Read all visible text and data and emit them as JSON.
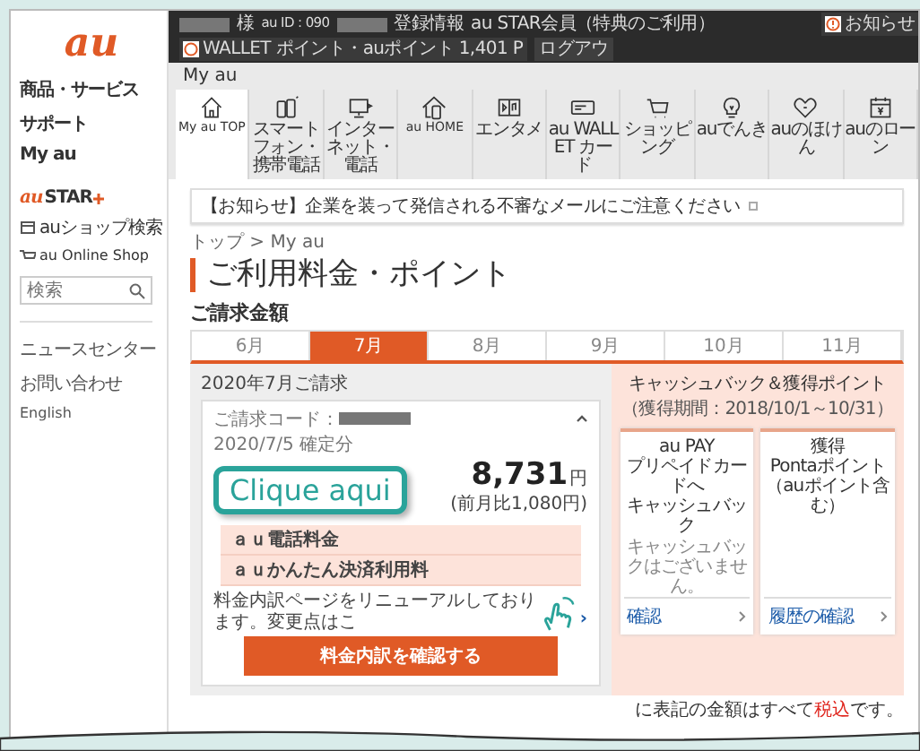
{
  "sidebar": {
    "logo": "au",
    "menu": [
      "商品・サービス",
      "サポート",
      "My au"
    ],
    "star_logo": {
      "brand": "au",
      "name": "STAR"
    },
    "links": [
      {
        "kind": "shop",
        "label": "auショップ検索"
      },
      {
        "kind": "online",
        "label": "au Online Shop"
      }
    ],
    "search": {
      "placeholder": "検索"
    },
    "footer_links": [
      "ニュースセンター",
      "お問い合わせ",
      "English"
    ]
  },
  "header": {
    "user_suffix": "様",
    "au_id": "au ID : 090",
    "links": [
      "登録情報",
      "au STAR会員（特典のご利用）"
    ],
    "notice": "お知らせ",
    "wallet": "WALLET ポイント・auポイント 1,401 P",
    "logout": "ログアウ"
  },
  "section_title": "My au",
  "nav": [
    {
      "kind": "home",
      "label": "My au TOP",
      "selected": true
    },
    {
      "kind": "phones",
      "label": "スマートフォン・携帯電話",
      "selected": false
    },
    {
      "kind": "monitor",
      "label": "インターネット・電話",
      "selected": false
    },
    {
      "kind": "house-phone",
      "label": "au HOME",
      "selected": false
    },
    {
      "kind": "media",
      "label": "エンタメ",
      "selected": false
    },
    {
      "kind": "card",
      "label": "au WALLET カード",
      "selected": false
    },
    {
      "kind": "cart",
      "label": "ショッピング",
      "selected": false
    },
    {
      "kind": "bulb",
      "label": "auでんき",
      "selected": false
    },
    {
      "kind": "heart",
      "label": "auのほけん",
      "selected": false
    },
    {
      "kind": "calendar",
      "label": "auのローン",
      "selected": false
    }
  ],
  "notice": "【お知らせ】企業を装って発信される不審なメールにご注意ください",
  "breadcrumb": "トップ > My au",
  "page_title": "ご利用料金・ポイント",
  "billing_heading": "ご請求金額",
  "months": [
    {
      "label": "6月",
      "selected": false
    },
    {
      "label": "7月",
      "selected": true
    },
    {
      "label": "8月",
      "selected": false
    },
    {
      "label": "9月",
      "selected": false
    },
    {
      "label": "10月",
      "selected": false
    },
    {
      "label": "11月",
      "selected": false
    }
  ],
  "bill": {
    "title": "2020年7月ご請求",
    "code_label": "ご請求コード：",
    "confirmed": "2020/7/5 確定分",
    "amount": "8,731",
    "unit": "円",
    "diff": "(前月比1,080円)",
    "expanded": true,
    "items": [
      "ａｕ電話料金",
      "ａｕかんたん決済利用料"
    ],
    "renewal_note": "料金内訳ページをリニューアルしております。変更点はこ",
    "renewal_arrow": "›",
    "button": "料金内訳を確認する"
  },
  "cashback": {
    "title": "キャッシュバック＆獲得ポイント",
    "period": "（獲得期間：2018/10/1～10/31）",
    "cards": [
      {
        "title_lines": [
          "au PAY",
          "プリペイドカードへ",
          "キャッシュバック"
        ],
        "note": "キャッシュバックはございません。",
        "link": "確認"
      },
      {
        "title_lines": [
          "獲得",
          "Pontaポイント",
          "（auポイント含む）"
        ],
        "link": "履歴の確認"
      }
    ]
  },
  "footer_note": {
    "before": "に表記の金額はすべて",
    "highlight": "税込",
    "after": "です。"
  },
  "overlay": {
    "callout": "Clique aqui"
  }
}
